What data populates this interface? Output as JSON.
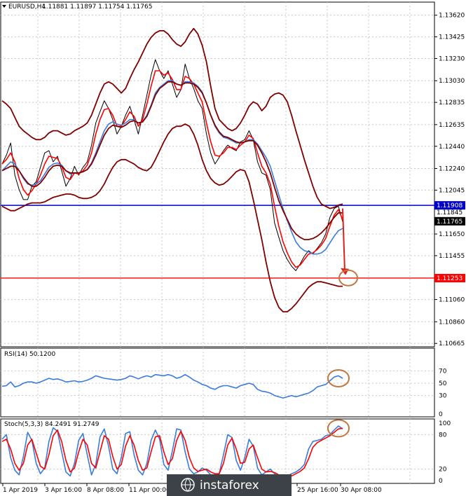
{
  "chart_data": [
    {
      "type": "line",
      "header": {
        "symbol": "EURUSD,H4",
        "values": [
          "1.11881",
          "1.11897",
          "1.11754",
          "1.11765"
        ]
      },
      "ylim": [
        1.1066,
        1.137
      ],
      "y_ticks": [
        "1.13620",
        "1.13425",
        "1.13230",
        "1.13030",
        "1.12835",
        "1.12635",
        "1.12440",
        "1.12240",
        "1.12045",
        "1.11650",
        "1.11455",
        "1.11060",
        "1.10860",
        "1.10665"
      ],
      "x_tick_labels": [
        "1 Apr 2019",
        "3 Apr 16:00",
        "8 Apr 08:00",
        "11 Apr 00:00",
        "25 Apr 16:00",
        "30 Apr 08:00"
      ],
      "horizontal_levels": [
        {
          "value": 1.11908,
          "label": "1.11908",
          "color": "#0000cc"
        },
        {
          "value": 1.11253,
          "label": "1.11253",
          "color": "#ff0000"
        }
      ],
      "price_labels": [
        {
          "value": 1.11845,
          "label": "1.11845"
        },
        {
          "value": 1.11765,
          "label": "1.11765"
        }
      ],
      "series": [
        {
          "role": "price",
          "color": "#000000",
          "values": [
            1.1228,
            1.1236,
            1.1247,
            1.1218,
            1.1205,
            1.1196,
            1.1196,
            1.1208,
            1.1212,
            1.1225,
            1.1238,
            1.124,
            1.123,
            1.1235,
            1.1222,
            1.1208,
            1.1215,
            1.1226,
            1.1218,
            1.1225,
            1.123,
            1.1245,
            1.1265,
            1.1275,
            1.1285,
            1.1278,
            1.1268,
            1.1255,
            1.1262,
            1.1272,
            1.128,
            1.1268,
            1.1255,
            1.1272,
            1.129,
            1.1308,
            1.1322,
            1.1312,
            1.1305,
            1.1312,
            1.13,
            1.1288,
            1.1295,
            1.1318,
            1.1305,
            1.1296,
            1.1285,
            1.1278,
            1.1255,
            1.1238,
            1.1228,
            1.1234,
            1.124,
            1.1245,
            1.1242,
            1.124,
            1.1248,
            1.125,
            1.1258,
            1.125,
            1.123,
            1.122,
            1.1218,
            1.1205,
            1.1175,
            1.1162,
            1.115,
            1.1142,
            1.1136,
            1.1132,
            1.1138,
            1.1145,
            1.115,
            1.1147,
            1.1152,
            1.1157,
            1.1165,
            1.118,
            1.1188,
            1.119,
            1.1176
          ]
        },
        {
          "role": "ma-fast",
          "color": "#ff0000",
          "values": [
            1.1228,
            1.1232,
            1.1238,
            1.123,
            1.1215,
            1.1205,
            1.12,
            1.1204,
            1.121,
            1.1218,
            1.1228,
            1.1235,
            1.1234,
            1.1233,
            1.1226,
            1.1216,
            1.1214,
            1.122,
            1.1219,
            1.1222,
            1.1227,
            1.1238,
            1.1255,
            1.1268,
            1.1277,
            1.1278,
            1.1272,
            1.1262,
            1.1262,
            1.1268,
            1.1275,
            1.1271,
            1.1262,
            1.1268,
            1.1282,
            1.1298,
            1.1312,
            1.1312,
            1.1308,
            1.131,
            1.1304,
            1.1295,
            1.1295,
            1.1307,
            1.1305,
            1.13,
            1.1292,
            1.1284,
            1.1265,
            1.1248,
            1.1236,
            1.1235,
            1.1238,
            1.1243,
            1.1243,
            1.1241,
            1.1245,
            1.1248,
            1.1254,
            1.1251,
            1.1238,
            1.1226,
            1.122,
            1.121,
            1.119,
            1.1172,
            1.1158,
            1.1148,
            1.114,
            1.1135,
            1.1137,
            1.1142,
            1.1147,
            1.1148,
            1.1151,
            1.1155,
            1.1161,
            1.1172,
            1.1182,
            1.1187,
            1.1178
          ]
        },
        {
          "role": "ma-slow",
          "color": "#3a7bdc",
          "values": [
            1.1222,
            1.1226,
            1.123,
            1.1228,
            1.1222,
            1.1215,
            1.121,
            1.1209,
            1.121,
            1.1213,
            1.1219,
            1.1225,
            1.1228,
            1.1229,
            1.1227,
            1.1222,
            1.1219,
            1.122,
            1.122,
            1.1221,
            1.1223,
            1.1229,
            1.1238,
            1.1248,
            1.1258,
            1.1264,
            1.1266,
            1.1264,
            1.1263,
            1.1265,
            1.1268,
            1.1268,
            1.1265,
            1.1266,
            1.1272,
            1.1281,
            1.1292,
            1.1297,
            1.13,
            1.1303,
            1.1303,
            1.13,
            1.1299,
            1.1302,
            1.1302,
            1.1301,
            1.1298,
            1.1293,
            1.1283,
            1.1272,
            1.1262,
            1.1256,
            1.1252,
            1.1251,
            1.1249,
            1.1247,
            1.1247,
            1.1248,
            1.125,
            1.125,
            1.1246,
            1.124,
            1.1234,
            1.1226,
            1.1213,
            1.12,
            1.1188,
            1.1177,
            1.1167,
            1.1158,
            1.1153,
            1.115,
            1.1149,
            1.1147,
            1.1147,
            1.1148,
            1.1151,
            1.1157,
            1.1163,
            1.1168,
            1.117
          ]
        },
        {
          "role": "bollinger-upper",
          "color": "#800000",
          "values": [
            1.1285,
            1.1282,
            1.1278,
            1.127,
            1.1262,
            1.1258,
            1.1255,
            1.1252,
            1.125,
            1.125,
            1.1252,
            1.1256,
            1.1258,
            1.1258,
            1.1256,
            1.1254,
            1.1255,
            1.1258,
            1.126,
            1.1262,
            1.1265,
            1.1272,
            1.1282,
            1.1292,
            1.13,
            1.1302,
            1.13,
            1.1296,
            1.1292,
            1.1296,
            1.1305,
            1.1313,
            1.132,
            1.1328,
            1.1336,
            1.1342,
            1.1346,
            1.1348,
            1.1348,
            1.1345,
            1.134,
            1.1336,
            1.1334,
            1.1338,
            1.1345,
            1.135,
            1.1345,
            1.1335,
            1.132,
            1.1298,
            1.1278,
            1.1268,
            1.1264,
            1.126,
            1.1258,
            1.126,
            1.1265,
            1.1272,
            1.128,
            1.1284,
            1.1282,
            1.1276,
            1.128,
            1.1288,
            1.1291,
            1.1292,
            1.129,
            1.1284,
            1.1272,
            1.1258,
            1.1245,
            1.1232,
            1.122,
            1.1208,
            1.1198,
            1.1192,
            1.119,
            1.1188,
            1.1189,
            1.1191,
            1.1192
          ]
        },
        {
          "role": "bollinger-middle",
          "color": "#800000",
          "values": [
            1.1222,
            1.1224,
            1.1226,
            1.1226,
            1.1222,
            1.1216,
            1.1211,
            1.1208,
            1.1208,
            1.1211,
            1.1216,
            1.1222,
            1.1226,
            1.1227,
            1.1226,
            1.1222,
            1.122,
            1.122,
            1.122,
            1.1221,
            1.1223,
            1.1228,
            1.1236,
            1.1245,
            1.1254,
            1.126,
            1.1263,
            1.1262,
            1.1261,
            1.1263,
            1.1266,
            1.1267,
            1.1265,
            1.1266,
            1.1271,
            1.128,
            1.129,
            1.1296,
            1.1299,
            1.1302,
            1.1302,
            1.13,
            1.1299,
            1.1301,
            1.1301,
            1.13,
            1.1297,
            1.1292,
            1.1283,
            1.1272,
            1.1263,
            1.1257,
            1.1253,
            1.1252,
            1.125,
            1.1248,
            1.1247,
            1.1248,
            1.1249,
            1.1249,
            1.1245,
            1.1238,
            1.123,
            1.122,
            1.1207,
            1.1195,
            1.1186,
            1.1178,
            1.117,
            1.1165,
            1.1162,
            1.116,
            1.116,
            1.1161,
            1.1163,
            1.1166,
            1.117,
            1.1175,
            1.118,
            1.1184,
            1.1184
          ]
        },
        {
          "role": "bollinger-lower",
          "color": "#800000",
          "values": [
            1.119,
            1.1188,
            1.1186,
            1.1186,
            1.1188,
            1.119,
            1.1192,
            1.1193,
            1.1193,
            1.1193,
            1.1194,
            1.1196,
            1.1198,
            1.1199,
            1.12,
            1.1201,
            1.1201,
            1.12,
            1.1198,
            1.1197,
            1.1197,
            1.1198,
            1.12,
            1.1204,
            1.121,
            1.1218,
            1.1225,
            1.123,
            1.1232,
            1.1232,
            1.123,
            1.1228,
            1.1225,
            1.1223,
            1.1222,
            1.1225,
            1.1232,
            1.124,
            1.1248,
            1.1255,
            1.126,
            1.1262,
            1.1262,
            1.1264,
            1.1262,
            1.1255,
            1.1245,
            1.1232,
            1.1222,
            1.1215,
            1.1211,
            1.1209,
            1.121,
            1.1213,
            1.1217,
            1.1221,
            1.1223,
            1.1222,
            1.1212,
            1.1196,
            1.1178,
            1.116,
            1.114,
            1.1122,
            1.1108,
            1.1099,
            1.1095,
            1.1095,
            1.1098,
            1.1102,
            1.1107,
            1.1112,
            1.1117,
            1.112,
            1.1122,
            1.1122,
            1.1121,
            1.112,
            1.1119,
            1.1118,
            1.1118
          ]
        }
      ],
      "forecast_arrow": {
        "from": 1.1188,
        "to": 1.1128,
        "color": "#e0201a"
      }
    },
    {
      "type": "line",
      "title": "RSI(14) 50.1200",
      "ylim": [
        0,
        100
      ],
      "y_ticks": [
        "70",
        "50",
        "30",
        "0"
      ],
      "levels": [
        70,
        50,
        30
      ],
      "series": [
        {
          "color": "#3a7bdc",
          "values": [
            45,
            46,
            52,
            44,
            46,
            50,
            52,
            52,
            50,
            52,
            55,
            58,
            56,
            57,
            55,
            52,
            53,
            54,
            52,
            53,
            55,
            58,
            62,
            60,
            58,
            57,
            56,
            55,
            56,
            58,
            62,
            60,
            57,
            60,
            62,
            60,
            64,
            63,
            62,
            64,
            62,
            58,
            60,
            64,
            60,
            55,
            52,
            48,
            46,
            42,
            40,
            44,
            46,
            46,
            44,
            42,
            46,
            48,
            50,
            48,
            40,
            37,
            36,
            34,
            30,
            28,
            26,
            28,
            30,
            28,
            30,
            32,
            34,
            38,
            44,
            46,
            48,
            54,
            60,
            62,
            58
          ]
        }
      ]
    },
    {
      "type": "line",
      "title": "Stoch(5,3,3) 84.2491 91.2749",
      "ylim": [
        0,
        100
      ],
      "y_ticks": [
        "100",
        "80",
        "20",
        "0"
      ],
      "levels": [
        80,
        20
      ],
      "series": [
        {
          "name": "main",
          "color": "#3a7bdc",
          "values": [
            72,
            80,
            40,
            18,
            10,
            42,
            84,
            70,
            30,
            12,
            22,
            68,
            92,
            86,
            50,
            15,
            8,
            30,
            70,
            82,
            45,
            10,
            28,
            76,
            90,
            60,
            20,
            12,
            40,
            82,
            85,
            45,
            18,
            10,
            30,
            70,
            88,
            72,
            28,
            18,
            52,
            90,
            88,
            50,
            20,
            12,
            15,
            22,
            18,
            10,
            8,
            12,
            45,
            80,
            75,
            35,
            18,
            40,
            72,
            60,
            22,
            10,
            15,
            20,
            12,
            5,
            3,
            8,
            12,
            15,
            20,
            28,
            55,
            68,
            70,
            72,
            78,
            80,
            88,
            95,
            90
          ]
        },
        {
          "name": "signal",
          "color": "#ff0000",
          "values": [
            68,
            72,
            55,
            30,
            18,
            30,
            62,
            72,
            48,
            25,
            20,
            45,
            78,
            88,
            68,
            35,
            15,
            22,
            50,
            72,
            62,
            30,
            22,
            50,
            78,
            72,
            42,
            20,
            28,
            60,
            78,
            62,
            35,
            18,
            22,
            50,
            76,
            78,
            50,
            28,
            38,
            70,
            86,
            70,
            40,
            22,
            16,
            18,
            20,
            15,
            12,
            12,
            30,
            62,
            74,
            55,
            30,
            32,
            55,
            62,
            40,
            20,
            15,
            16,
            14,
            10,
            6,
            6,
            8,
            12,
            16,
            22,
            38,
            58,
            66,
            70,
            74,
            78,
            84,
            90,
            91
          ]
        }
      ]
    }
  ],
  "watermark": "instaforex"
}
